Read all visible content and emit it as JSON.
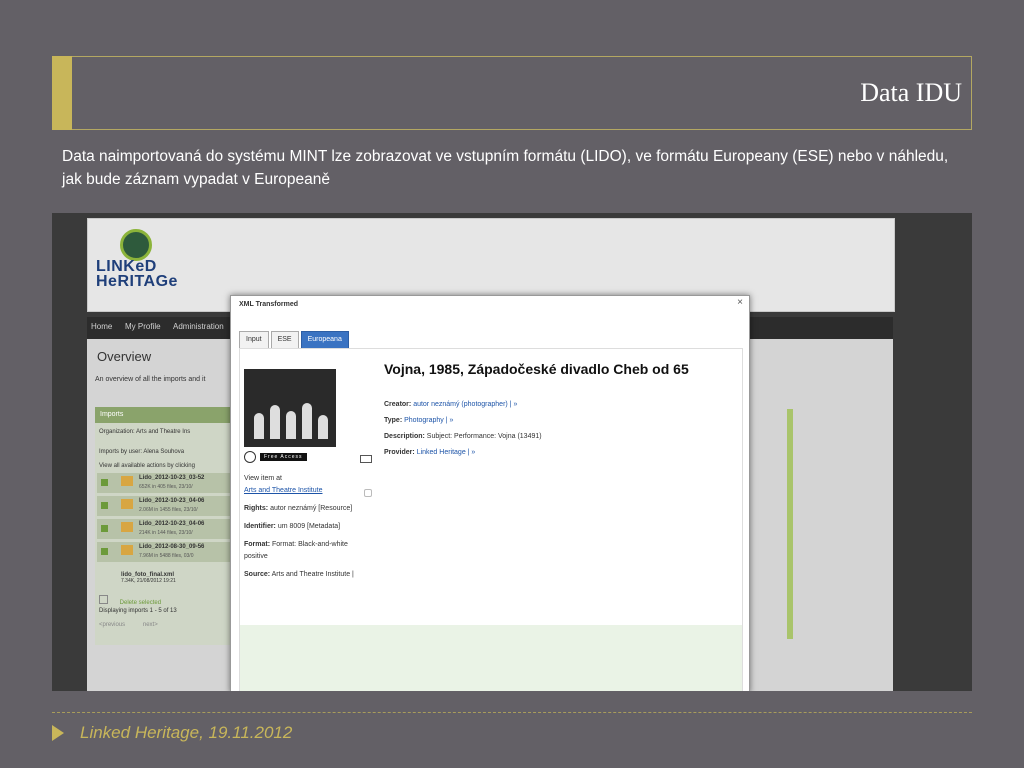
{
  "slide": {
    "title": "Data IDU",
    "intro": "Data naimportovaná do systému MINT lze zobrazovat ve vstupním formátu (LIDO), ve formátu Europeany (ESE) nebo v náhledu, jak bude záznam vypadat v Europeaně",
    "footer": "Linked Heritage, 19.11.2012"
  },
  "site": {
    "logo_line1": "LINKeD",
    "logo_line2": "HeRITAGe",
    "nav": [
      "Home",
      "My Profile",
      "Administration"
    ],
    "overview_title": "Overview",
    "overview_desc": "An overview of all the imports and it",
    "imports": {
      "header": "Imports",
      "organization_label": "Organization:",
      "organization_value": "Arts and Theatre Ins",
      "user_label": "Imports by user:",
      "user_value": "Alena Souhova",
      "actions_hint": "View all available actions by clicking",
      "entries": [
        {
          "name": "Lido_2012-10-23_03-52",
          "meta": "652K in 405 files, 23/10/"
        },
        {
          "name": "Lido_2012-10-23_04-06",
          "meta": "2.06M in 1455 files, 23/10/"
        },
        {
          "name": "Lido_2012-10-23_04-06",
          "meta": "214K in 144 files, 23/10/"
        },
        {
          "name": "Lido_2012-08-30_09-56",
          "meta": "7.96M in 5488 files, 03/0"
        }
      ],
      "last_file": "lido_foto_final.xml",
      "last_meta": "7.34K, 21/08/2012 19:21",
      "delete_label": "Delete selected",
      "displaying": "Displaying imports 1 - 5 of 13",
      "prev": "<previous",
      "next": "next>"
    }
  },
  "modal": {
    "title": "XML Transformed",
    "close": "×",
    "tabs": [
      "Input",
      "ESE",
      "Europeana"
    ],
    "active_tab": "Europeana",
    "free_access": "Free Access",
    "view_item": "View item at",
    "institution_link": "Arts and Theatre Institute",
    "rights_label": "Rights:",
    "rights_value": "autor neznámý [Resource]",
    "identifier_label": "Identifier:",
    "identifier_value": "um 8009 [Metadata]",
    "format_label": "Format:",
    "format_value": "Format: Black-and-white positive",
    "source_label": "Source:",
    "source_value": "Arts and Theatre Institute |",
    "record_title": "Vojna, 1985, Západočeské divadlo Cheb od 65",
    "creator_label": "Creator:",
    "creator_value": "autor neznámý (photographer) | »",
    "type_label": "Type:",
    "type_value": "Photography | »",
    "description_label": "Description:",
    "description_value": "Subject: Performance: Vojna (13491)",
    "provider_label": "Provider:",
    "provider_value": "Linked Heritage | »"
  },
  "colors": {
    "background": "#636066",
    "accent": "#c8b65a",
    "tab_active": "#3a73c2"
  }
}
